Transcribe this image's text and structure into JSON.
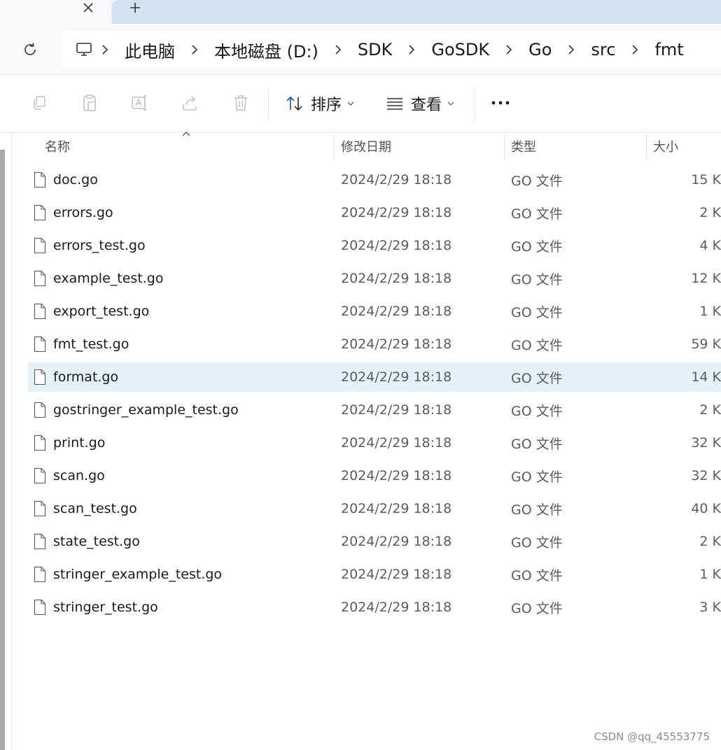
{
  "tabs": {
    "close_glyph": "✕",
    "new_glyph": "+"
  },
  "breadcrumb": {
    "items": [
      "此电脑",
      "本地磁盘 (D:)",
      "SDK",
      "GoSDK",
      "Go",
      "src",
      "fmt"
    ]
  },
  "toolbar": {
    "sort_label": "排序",
    "view_label": "查看",
    "more_label": "···"
  },
  "columns": {
    "name": "名称",
    "date": "修改日期",
    "type": "类型",
    "size": "大小"
  },
  "files": [
    {
      "name": "doc.go",
      "date": "2024/2/29 18:18",
      "type": "GO 文件",
      "size": "15 K"
    },
    {
      "name": "errors.go",
      "date": "2024/2/29 18:18",
      "type": "GO 文件",
      "size": "2 K"
    },
    {
      "name": "errors_test.go",
      "date": "2024/2/29 18:18",
      "type": "GO 文件",
      "size": "4 K"
    },
    {
      "name": "example_test.go",
      "date": "2024/2/29 18:18",
      "type": "GO 文件",
      "size": "12 K"
    },
    {
      "name": "export_test.go",
      "date": "2024/2/29 18:18",
      "type": "GO 文件",
      "size": "1 K"
    },
    {
      "name": "fmt_test.go",
      "date": "2024/2/29 18:18",
      "type": "GO 文件",
      "size": "59 K"
    },
    {
      "name": "format.go",
      "date": "2024/2/29 18:18",
      "type": "GO 文件",
      "size": "14 K"
    },
    {
      "name": "gostringer_example_test.go",
      "date": "2024/2/29 18:18",
      "type": "GO 文件",
      "size": "2 K"
    },
    {
      "name": "print.go",
      "date": "2024/2/29 18:18",
      "type": "GO 文件",
      "size": "32 K"
    },
    {
      "name": "scan.go",
      "date": "2024/2/29 18:18",
      "type": "GO 文件",
      "size": "32 K"
    },
    {
      "name": "scan_test.go",
      "date": "2024/2/29 18:18",
      "type": "GO 文件",
      "size": "40 K"
    },
    {
      "name": "state_test.go",
      "date": "2024/2/29 18:18",
      "type": "GO 文件",
      "size": "2 K"
    },
    {
      "name": "stringer_example_test.go",
      "date": "2024/2/29 18:18",
      "type": "GO 文件",
      "size": "1 K"
    },
    {
      "name": "stringer_test.go",
      "date": "2024/2/29 18:18",
      "type": "GO 文件",
      "size": "3 K"
    }
  ],
  "selected_file": "format.go",
  "watermark": "CSDN @qq_45553775",
  "colors": {
    "selected_row": "#e5f1fb",
    "tab_strip": "#d3e2f0",
    "header_text": "#4a5563"
  }
}
